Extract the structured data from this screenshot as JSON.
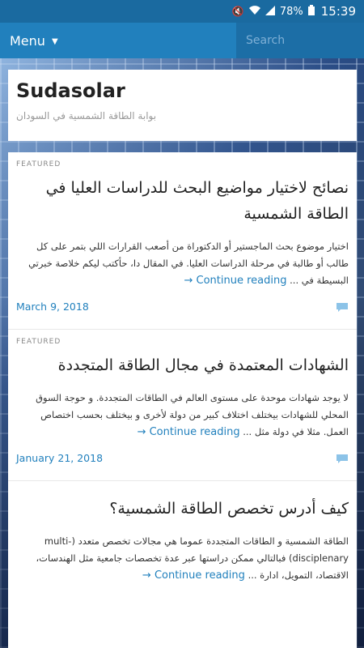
{
  "statusbar": {
    "icons": [
      "mute-icon",
      "wifi-icon",
      "signal-icon"
    ],
    "battery": "78%",
    "time": "15:39"
  },
  "nav": {
    "menu_label": "Menu",
    "search_placeholder": "Search"
  },
  "header": {
    "title": "Sudasolar",
    "description": "بوابة الطاقة الشمسية في السودان"
  },
  "posts": [
    {
      "label": "FEATURED",
      "title": "نصائح لاختيار مواضيع البحث للدراسات العليا في الطاقة الشمسية",
      "excerpt": "اختيار موضوع بحث الماجستير أو الدكتوراة من أصعب القرارات اللي بتمر على كل طالب أو طالبة في مرحلة الدراسات العليا. في المقال دا، حأكتب ليكم خلاصة خبرتي البسيطة في ...",
      "more": "Continue reading →",
      "date": "March 9, 2018"
    },
    {
      "label": "FEATURED",
      "title": "الشهادات المعتمدة في مجال الطاقة المتجددة",
      "excerpt": "لا يوجد شهادات موحدة على مستوى العالم في الطاقات المتجددة. و حوجة السوق المحلي للشهادات بيختلف اختلاف كبير من دولة لأخرى و بيختلف بحسب اختصاص العمل. مثلا في دولة مثل ...",
      "more": "Continue reading →",
      "date": "January 21, 2018"
    },
    {
      "label": "",
      "title": "كيف أدرس تخصص الطاقة الشمسية؟",
      "excerpt": "الطاقة الشمسية و الطاقات المتجددة عموما هي مجالات تخصص متعدد (multi-disciplenary) فبالتالي ممكن دراستها عبر عدة تخصصات جامعية مثل الهندسات، الاقتصاد، التمويل، ادارة ...",
      "more": "Continue reading →",
      "date": ""
    }
  ],
  "colors": {
    "accent": "#2180bd",
    "nav_bg": "#2180bd",
    "statusbar_bg": "#1a6aa0"
  }
}
